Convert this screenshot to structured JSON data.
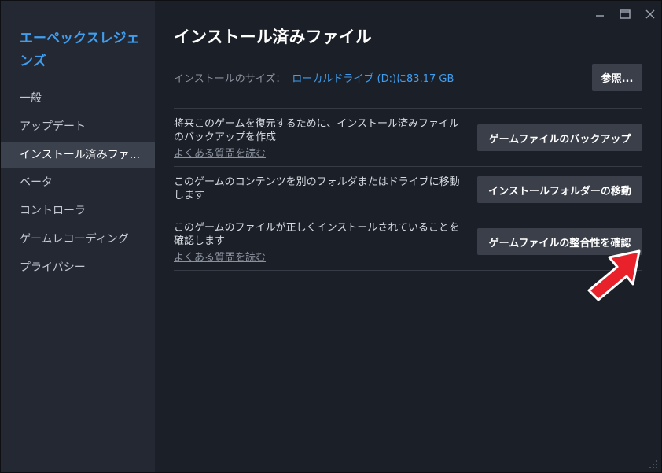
{
  "sidebar": {
    "game_title": "エーペックスレジェンズ",
    "items": [
      {
        "label": "一般"
      },
      {
        "label": "アップデート"
      },
      {
        "label": "インストール済みファ..."
      },
      {
        "label": "ベータ"
      },
      {
        "label": "コントローラ"
      },
      {
        "label": "ゲームレコーディング"
      },
      {
        "label": "プライバシー"
      }
    ],
    "active_index": 2
  },
  "window_controls": {
    "minimize": "minimize-icon",
    "maximize": "maximize-icon",
    "close": "close-icon"
  },
  "main": {
    "title": "インストール済みファイル",
    "install_size_label": "インストールのサイズ：",
    "install_size_value": "ローカルドライブ (D:)に83.17 GB",
    "browse_button": "参照...",
    "rows": [
      {
        "description": "将来このゲームを復元するために、インストール済みファイルのバックアップを作成",
        "faq_link": "よくある質問を読む",
        "button": "ゲームファイルのバックアップ"
      },
      {
        "description": "このゲームのコンテンツを別のフォルダまたはドライブに移動します",
        "button": "インストールフォルダーの移動"
      },
      {
        "description": "このゲームのファイルが正しくインストールされていることを確認します",
        "faq_link": "よくある質問を読む",
        "button": "ゲームファイルの整合性を確認"
      }
    ]
  },
  "colors": {
    "accent": "#3f9ef0",
    "annotation_arrow": "#e8212b"
  }
}
